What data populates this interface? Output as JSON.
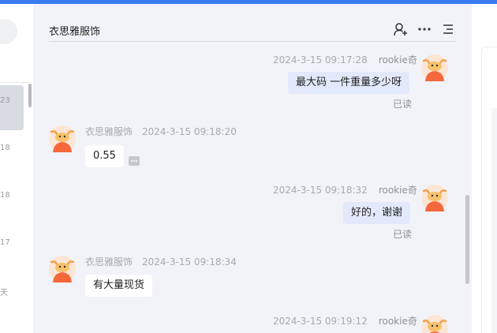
{
  "sidebar": {
    "dates": [
      "23",
      "18",
      "18",
      "17",
      "天"
    ]
  },
  "chat": {
    "title": "衣思雅服饰",
    "messages": [
      {
        "sender": "rookie奇",
        "time": "2024-3-15 09:17:28",
        "text": "最大码 一件重量多少呀",
        "status": "已读",
        "mine": true
      },
      {
        "sender": "衣思雅服饰",
        "time": "2024-3-15 09:18:20",
        "text": "0.55",
        "mine": false
      },
      {
        "sender": "rookie奇",
        "time": "2024-3-15 09:18:32",
        "text": "好的，谢谢",
        "status": "已读",
        "mine": true
      },
      {
        "sender": "衣思雅服饰",
        "time": "2024-3-15 09:18:34",
        "text": "有大量现货",
        "mine": false
      },
      {
        "sender": "rookie奇",
        "time": "2024-3-15 09:19:12",
        "mine": true
      }
    ]
  },
  "colors": {
    "accent": "#3a7bf2",
    "chat_bg": "#f2f3f8",
    "my_bubble": "#e2e9fb",
    "avatar_orange": "#f4683c"
  },
  "icons": [
    "add-contact-icon",
    "more-icon",
    "menu-icon",
    "cow-avatar-icon"
  ]
}
